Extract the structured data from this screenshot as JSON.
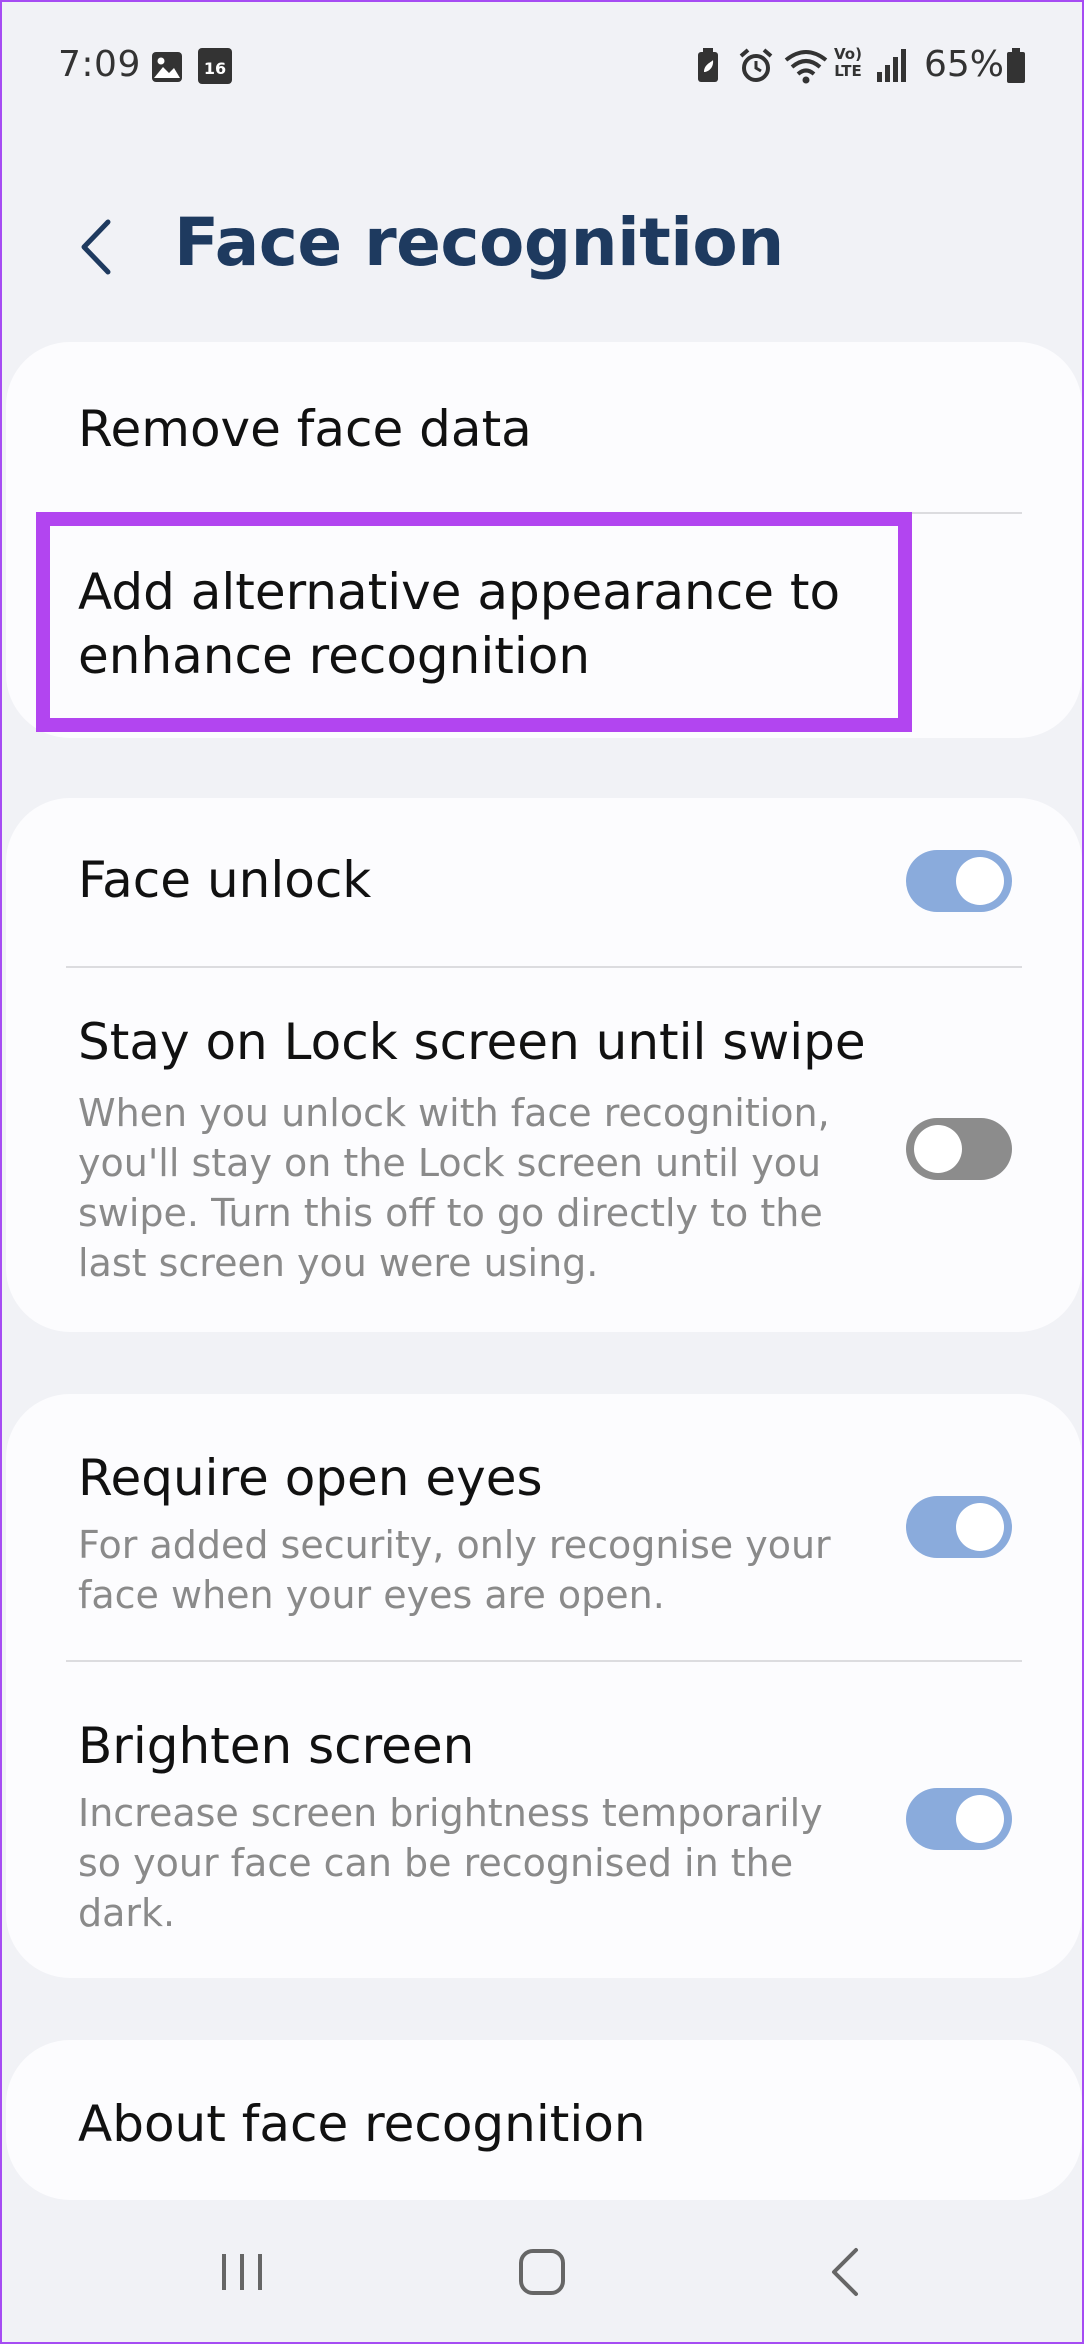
{
  "status_bar": {
    "time": "7:09",
    "calendar_day": "16",
    "battery_percent": "65%",
    "icons": [
      "gallery-icon",
      "calendar-icon",
      "battery-saver-icon",
      "alarm-icon",
      "wifi-icon",
      "volte-icon",
      "signal-icon",
      "battery-icon"
    ]
  },
  "header": {
    "title": "Face recognition"
  },
  "card1": {
    "items": [
      {
        "title": "Remove face data"
      },
      {
        "title": "Add alternative appearance to enhance recognition",
        "line1": "Add alternative appearance to",
        "line2": "enhance recognition"
      }
    ]
  },
  "card2": {
    "face_unlock": {
      "title": "Face unlock",
      "enabled": true
    },
    "stay_on_lock": {
      "title": "Stay on Lock screen until swipe",
      "sub_lines": [
        "When you unlock with face recognition,",
        "you'll stay on the Lock screen until you",
        "swipe. Turn this off to go directly to the",
        "last screen you were using."
      ],
      "enabled": false
    }
  },
  "card3": {
    "require_open_eyes": {
      "title": "Require open eyes",
      "sub_lines": [
        "For added security, only recognise your",
        "face when your eyes are open."
      ],
      "enabled": true
    },
    "brighten_screen": {
      "title": "Brighten screen",
      "sub_lines": [
        "Increase screen brightness temporarily",
        "so your face can be recognised in the",
        "dark."
      ],
      "enabled": true
    }
  },
  "card4": {
    "about": {
      "title": "About face recognition"
    }
  },
  "colors": {
    "background": "#f1f2f6",
    "card": "#fcfcfe",
    "title": "#1e3a5f",
    "toggle_on": "#8aabdc",
    "toggle_off": "#8c8c8c",
    "highlight": "#b245f0"
  }
}
